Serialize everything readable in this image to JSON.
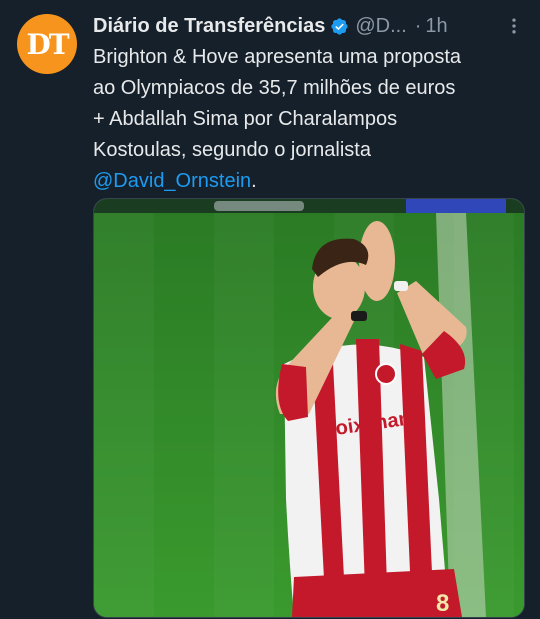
{
  "account": {
    "avatar_text": "DT",
    "name": "Diário de Transferências",
    "handle": "@D...",
    "dot": "·",
    "time": "1h"
  },
  "tweet": {
    "lines": [
      "Brighton & Hove apresenta uma proposta",
      "ao Olympiacos de 35,7 milhões de euros",
      "+ Abdallah Sima por Charalampos",
      "Kostoulas, segundo o jornalista"
    ],
    "mention": "@David_Ornstein",
    "tail": "."
  },
  "media": {
    "jersey_text": "Stoiximan",
    "jersey_number": "8"
  },
  "colors": {
    "background": "#15202b",
    "accent": "#1d9bf0",
    "avatar": "#f7941d",
    "pitch": "#2f8a2a",
    "jersey_red": "#c4192b"
  }
}
